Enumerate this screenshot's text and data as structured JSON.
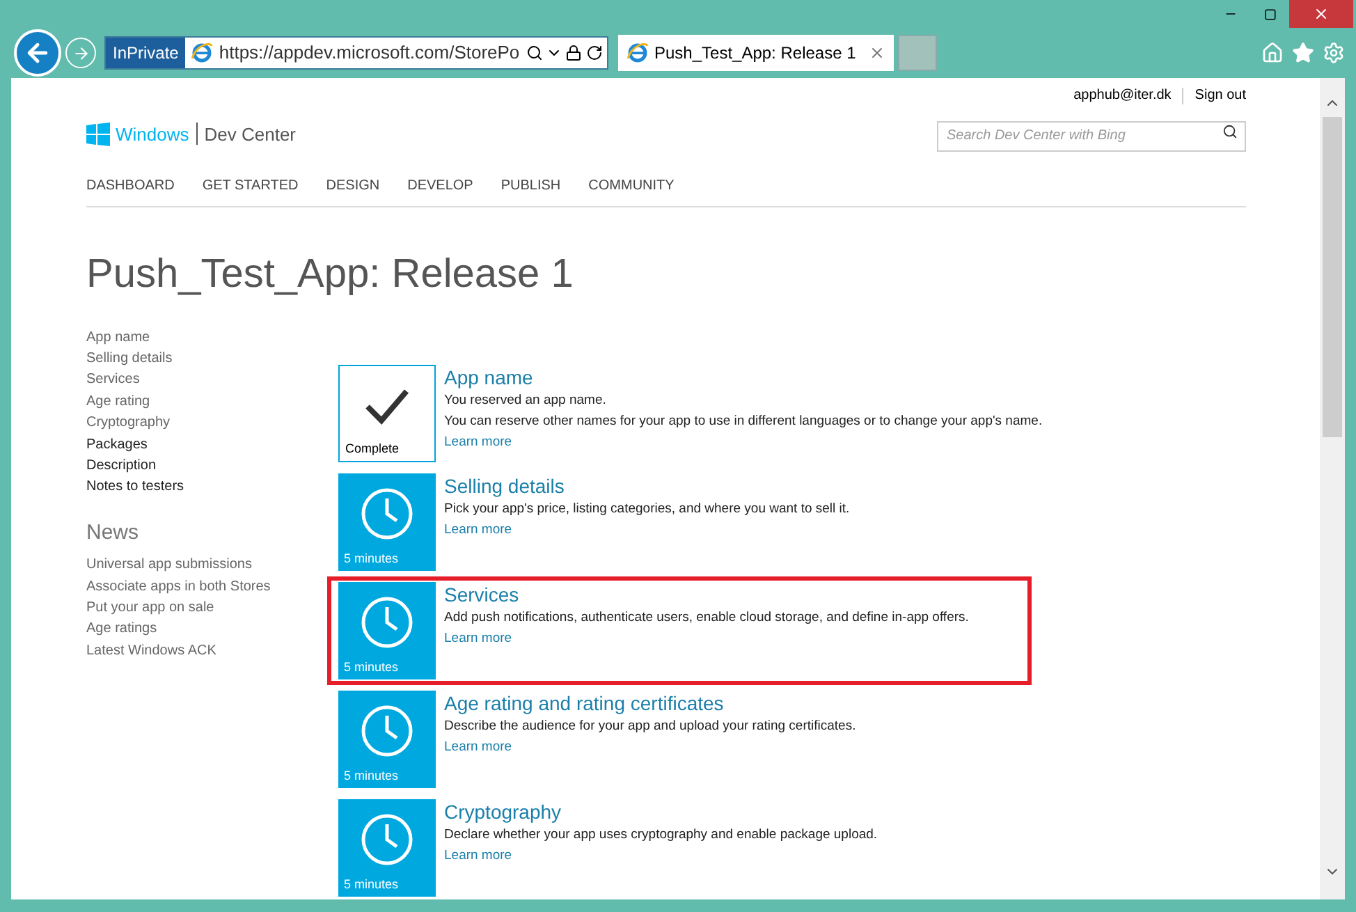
{
  "browser": {
    "address": "https://appdev.microsoft.com/StorePo",
    "inprivate": "InPrivate",
    "tabs": [
      {
        "title": "Push_Test_App: Release 1",
        "selected": true
      }
    ]
  },
  "header": {
    "user": "apphub@iter.dk",
    "signout": "Sign out",
    "brand": "Windows",
    "site": "Dev Center",
    "search": {
      "placeholder": "Search Dev Center with Bing"
    }
  },
  "nav": [
    "DASHBOARD",
    "GET STARTED",
    "DESIGN",
    "DEVELOP",
    "PUBLISH",
    "COMMUNITY"
  ],
  "title": "Push_Test_App: Release 1",
  "sidebar": {
    "items": [
      {
        "label": "App name",
        "kind": "link"
      },
      {
        "label": "Selling details",
        "kind": "link"
      },
      {
        "label": "Services",
        "kind": "link"
      },
      {
        "label": "Age rating",
        "kind": "link"
      },
      {
        "label": "Cryptography",
        "kind": "link"
      },
      {
        "label": "Packages",
        "kind": "plain"
      },
      {
        "label": "Description",
        "kind": "plain"
      },
      {
        "label": "Notes to testers",
        "kind": "plain"
      }
    ],
    "news_title": "News",
    "news": [
      "Universal app submissions",
      "Associate apps in both Stores",
      "Put your app on sale",
      "Age ratings",
      "Latest Windows ACK"
    ]
  },
  "steps": [
    {
      "title": "App name",
      "kind": "complete",
      "tile": "Complete",
      "highlighted": false,
      "lines": [
        "You reserved an app name.",
        "You can reserve other names for your app to use in different languages or to change your app's name."
      ],
      "link": "Learn more"
    },
    {
      "title": "Selling details",
      "kind": "pending",
      "tile": "5 minutes",
      "highlighted": false,
      "lines": [
        "Pick your app's price, listing categories, and where you want to sell it."
      ],
      "link": "Learn more"
    },
    {
      "title": "Services",
      "kind": "pending",
      "tile": "5 minutes",
      "highlighted": true,
      "lines": [
        "Add push notifications, authenticate users, enable cloud storage, and define in-app offers."
      ],
      "link": "Learn more"
    },
    {
      "title": "Age rating and rating certificates",
      "kind": "pending",
      "tile": "5 minutes",
      "highlighted": false,
      "lines": [
        "Describe the audience for your app and upload your rating certificates."
      ],
      "link": "Learn more"
    },
    {
      "title": "Cryptography",
      "kind": "pending",
      "tile": "5 minutes",
      "highlighted": false,
      "lines": [
        "Declare whether your app uses cryptography and enable package upload."
      ],
      "link": "Learn more"
    }
  ]
}
